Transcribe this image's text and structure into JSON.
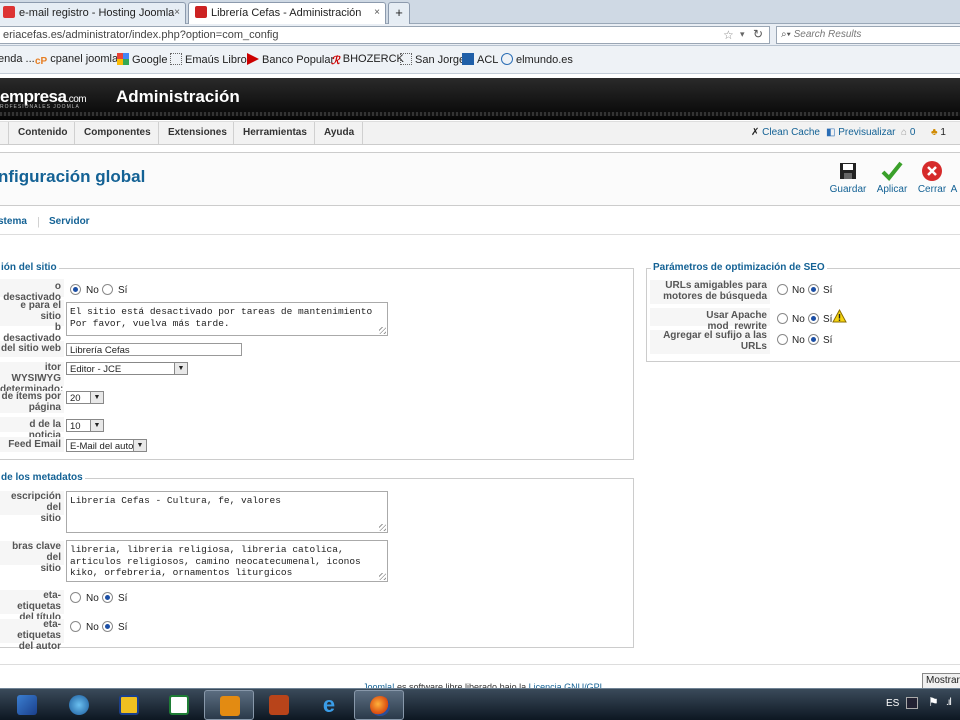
{
  "browser": {
    "tabs": [
      {
        "title": "e-mail registro - Hosting Joomla",
        "close": "×"
      },
      {
        "title": "Librería Cefas - Administración",
        "close": "×"
      }
    ],
    "new_tab": "+",
    "url": "eriacefas.es/administrator/index.php?option=com_config",
    "search_placeholder": "Search Results",
    "bookmarks": [
      "enda ...",
      "cpanel joomla",
      "Google",
      "Emaús Libros",
      "Banco Popular",
      "BHOZERCK",
      "San Jorge",
      "ACL",
      "elmundo.es"
    ]
  },
  "header": {
    "logo": "empresa",
    "logo_suffix": ".com",
    "logo_sub": "ROFESIONALES JOOMLA",
    "title": "Administración"
  },
  "menu": {
    "items": [
      "Contenido",
      "Componentes",
      "Extensiones",
      "Herramientas",
      "Ayuda"
    ],
    "clean_cache": "Clean Cache",
    "preview": "Previsualizar",
    "count_a": "0",
    "count_b": "1"
  },
  "toolbar": {
    "page_title": "nfiguración global",
    "save": "Guardar",
    "apply": "Aplicar",
    "close": "Cerrar"
  },
  "subnav": [
    "stema",
    "Servidor"
  ],
  "site": {
    "legend": "ión del sitio",
    "offline_label": "o desactivado",
    "offline_value": "No",
    "offline_msg_label_1": "e para el sitio",
    "offline_msg_label_2": "b desactivado",
    "offline_msg": "El sitio está desactivado por tareas de mantenimiento\nPor favor, vuelva más tarde.",
    "sitename_label": "del sitio web",
    "sitename": "Librería Cefas",
    "editor_label_1": "itor WYSIWYG",
    "editor_label_2": "determinado:",
    "editor": "Editor - JCE",
    "items_label_1": "de ítems por",
    "items_label_2": "página",
    "items": "20",
    "feed_len_label": "d de la noticia",
    "feed_len": "10",
    "feed_email_label": "Feed Email",
    "feed_email": "E-Mail del autor"
  },
  "meta": {
    "legend": "de los metadatos",
    "desc_label_1": "escripción del",
    "desc_label_2": "sitio",
    "description": "Librería Cefas - Cultura, fe, valores",
    "keys_label_1": "bras clave del",
    "keys_label_2": "sitio",
    "keywords": "libreria, libreria religiosa, libreria catolica,\narticulos religiosos, camino neocatecumenal, iconos\nkiko, orfebreria, ornamentos liturgicos",
    "title_meta_label_1": "eta-etiquetas",
    "title_meta_label_2": "del título",
    "author_meta_label_1": "eta-etiquetas",
    "author_meta_label_2": "del autor"
  },
  "seo": {
    "legend": "Parámetros de optimización de SEO",
    "sef_label_1": "URLs amigables para",
    "sef_label_2": "motores de búsqueda",
    "rewrite_label": "Usar Apache mod_rewrite",
    "suffix_label_1": "Agregar el sufijo a las",
    "suffix_label_2": "URLs"
  },
  "radio": {
    "no": "No",
    "yes": "Sí"
  },
  "footer": {
    "joomla": "Joomla!",
    "text": " es software libre liberado bajo la ",
    "license": "Licencia GNU/GPL"
  },
  "taskbar": {
    "mostrar": "Mostrar",
    "lang": "ES"
  }
}
